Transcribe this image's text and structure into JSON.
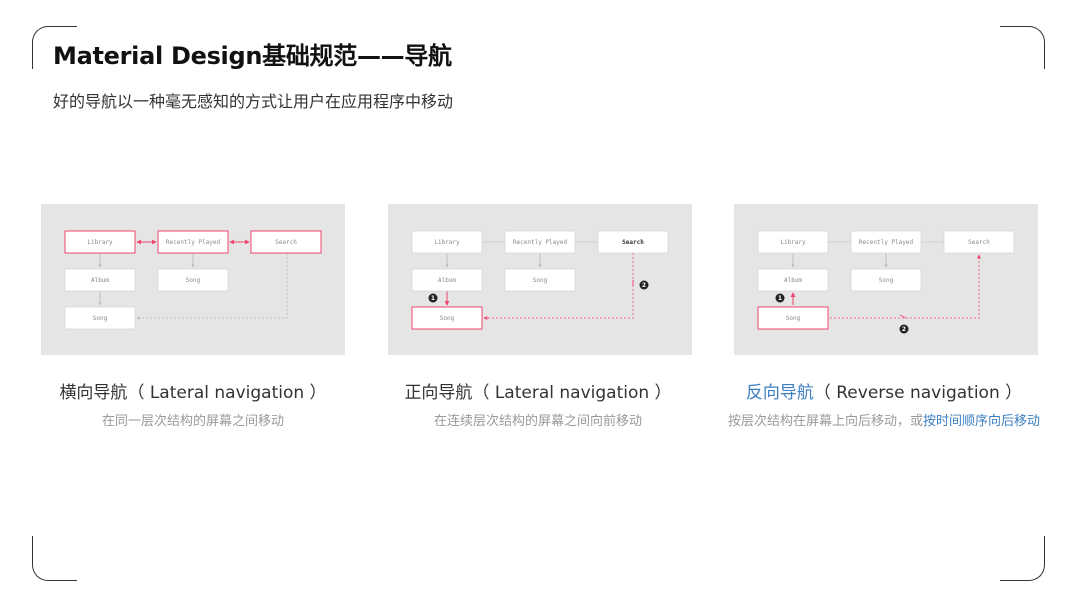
{
  "header": {
    "title": "Material Design基础规范——导航",
    "subtitle": "好的导航以一种毫无感知的方式让用户在应用程序中移动"
  },
  "colors": {
    "accent": "#f0456e",
    "panel_bg": "#e5e5e5",
    "link_blue": "#3d7fc0"
  },
  "panels": [
    {
      "nodes": [
        "Library",
        "Recently Played",
        "Search",
        "Album",
        "Song",
        "Song"
      ],
      "caption_cn": "横向导航",
      "caption_en": "（ Lateral navigation ）",
      "desc": "在同一层次结构的屏幕之间移动"
    },
    {
      "nodes": [
        "Library",
        "Recently Played",
        "Search",
        "Album",
        "Song",
        "Song"
      ],
      "badges": [
        "1",
        "2"
      ],
      "caption_cn": "正向导航",
      "caption_en": "（ Lateral navigation ）",
      "desc": "在连续层次结构的屏幕之间向前移动"
    },
    {
      "nodes": [
        "Library",
        "Recently Played",
        "Search",
        "Album",
        "Song",
        "Song"
      ],
      "badges": [
        "1",
        "2"
      ],
      "caption_cn": "反向导航",
      "caption_en": "（ Reverse navigation ）",
      "desc_gray": "按层次结构在屏幕上向后移动，或",
      "desc_blue": "按时间顺序向后移动"
    }
  ]
}
